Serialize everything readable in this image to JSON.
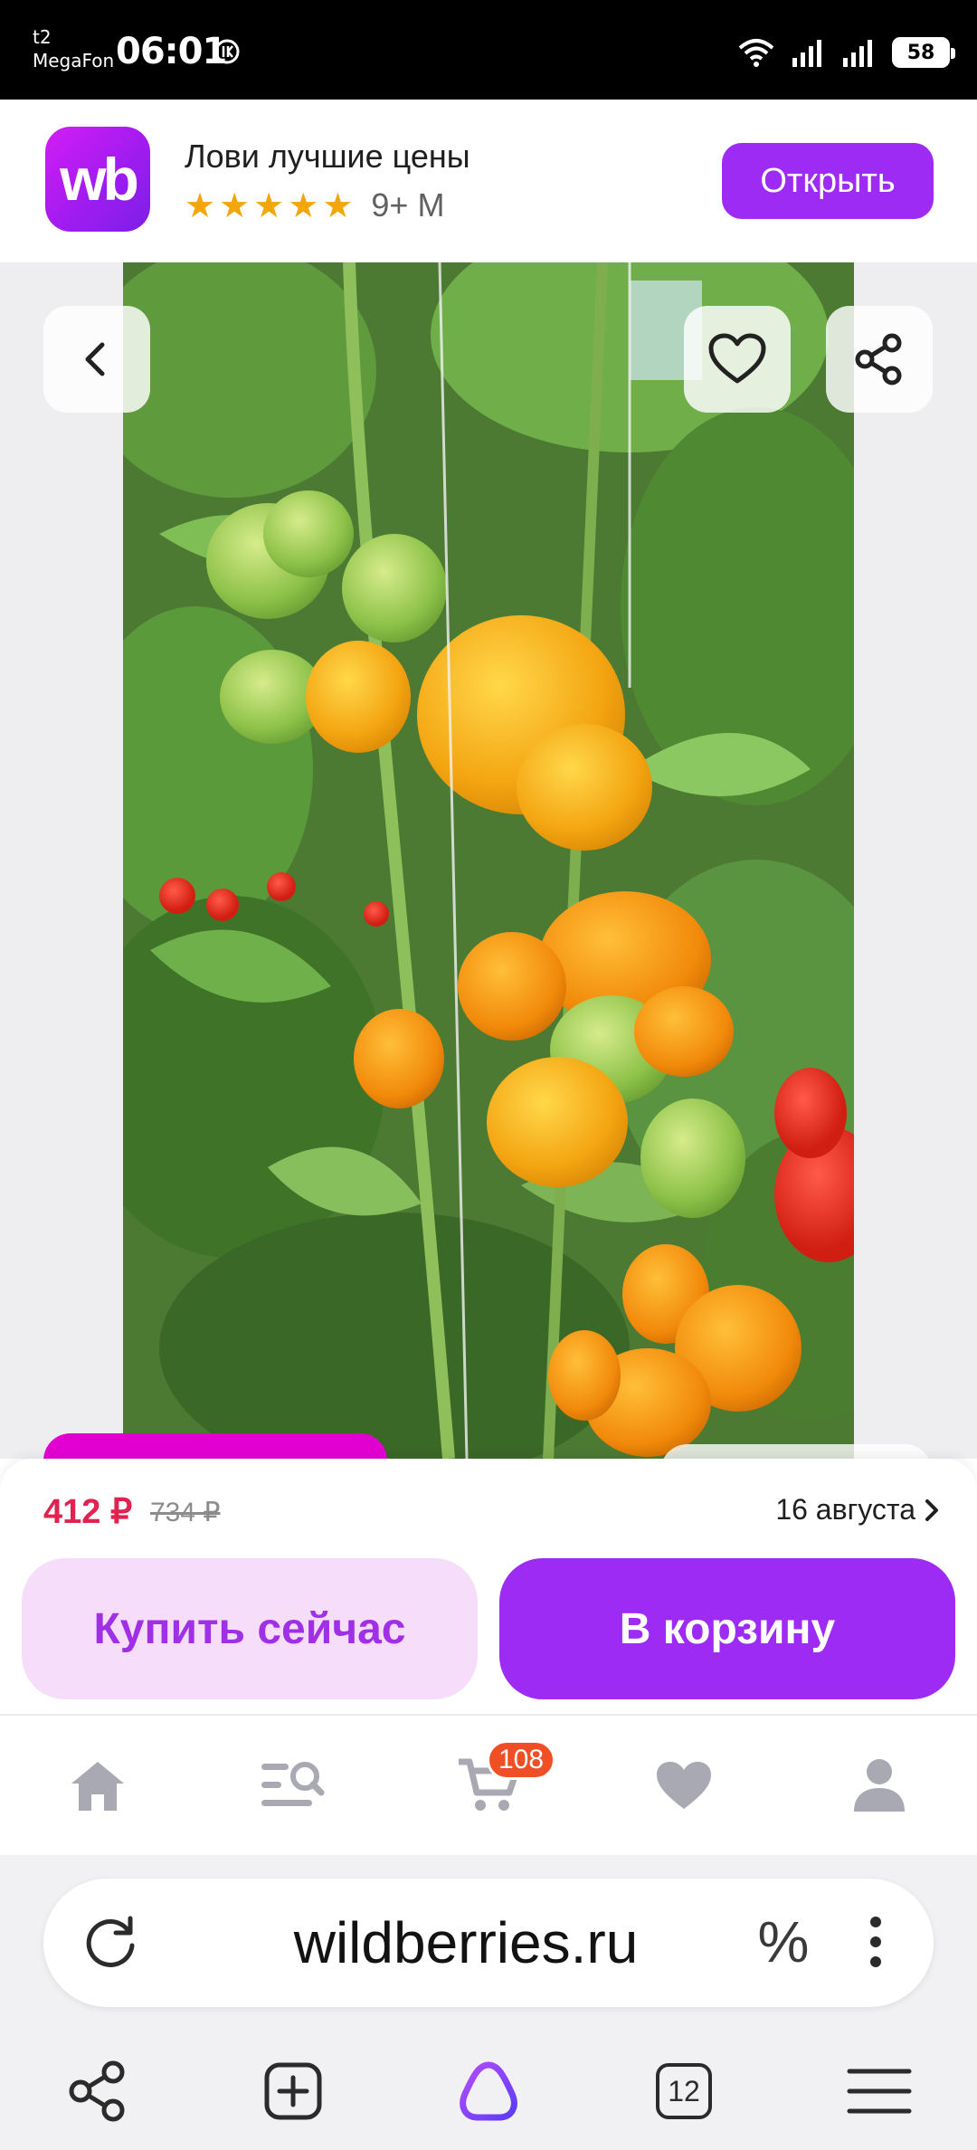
{
  "status_bar": {
    "carrier_line1": "t2",
    "carrier_line2": "MegaFon",
    "time": "06:01",
    "battery": "58"
  },
  "app_banner": {
    "logo_text": "wb",
    "title": "Лови лучшие цены",
    "stars": [
      "★",
      "★",
      "★",
      "★",
      "★"
    ],
    "rating": "9+ М",
    "open_label": "Открыть"
  },
  "product": {
    "price": "412 ₽",
    "old_price": "734 ₽",
    "delivery_date": "16 августа",
    "buy_now_label": "Купить сейчас",
    "add_to_cart_label": "В корзину"
  },
  "tabbar": {
    "cart_badge": "108"
  },
  "browser": {
    "url": "wildberries.ru",
    "discount_icon": "%",
    "tabs_count": "12"
  },
  "colors": {
    "brand": "#9e2bf3",
    "price": "#e0224f",
    "buy_now_bg": "#f6defa",
    "badge": "#f04e24"
  },
  "icons": {
    "back": "chevron-left-icon",
    "favorite": "heart-icon",
    "share": "share-icon",
    "home": "home-icon",
    "catalog": "catalog-search-icon",
    "cart": "cart-icon",
    "favorites": "heart-icon",
    "profile": "profile-icon",
    "reload": "reload-icon",
    "menu": "more-vertical-icon",
    "browser_share": "share-icon",
    "new_tab": "plus-square-icon",
    "alice": "alice-icon",
    "tabs": "tabs-icon",
    "hamburger": "hamburger-icon"
  }
}
